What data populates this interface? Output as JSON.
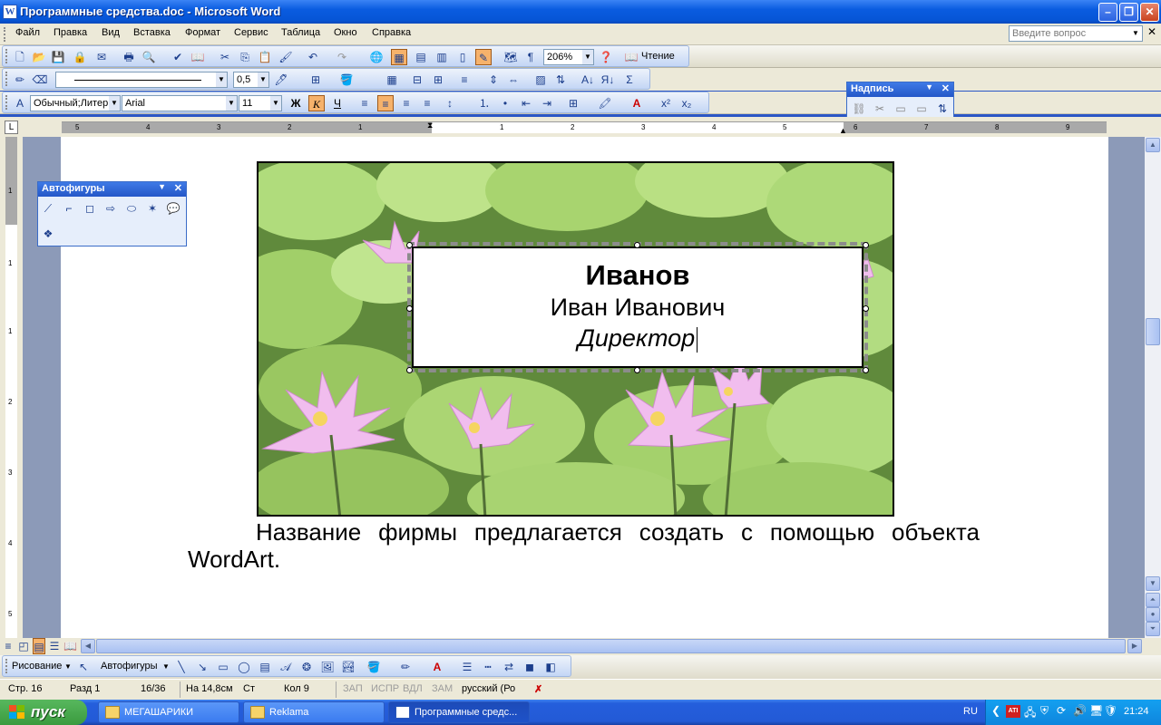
{
  "window": {
    "title": "Программные средства.doc - Microsoft Word",
    "app_icon": "W"
  },
  "menu": {
    "items": [
      "Файл",
      "Правка",
      "Вид",
      "Вставка",
      "Формат",
      "Сервис",
      "Таблица",
      "Окно",
      "Справка"
    ],
    "ask_placeholder": "Введите вопрос"
  },
  "standard_toolbar": {
    "zoom": "206%",
    "reading_label": "Чтение"
  },
  "drawing_format_toolbar": {
    "line_weight": "0,5"
  },
  "formatting_toolbar": {
    "style": "Обычный;Литер",
    "font": "Arial",
    "size": "11",
    "bold": "Ж",
    "italic": "К",
    "underline": "Ч"
  },
  "floating": {
    "textbox_toolbar_title": "Надпись",
    "autoshapes_toolbar_title": "Автофигуры"
  },
  "ruler": {
    "h_numbers": [
      "5",
      "4",
      "3",
      "2",
      "1",
      "1",
      "2",
      "3",
      "4",
      "5",
      "6",
      "7",
      "8",
      "9"
    ],
    "v_numbers": [
      "1",
      "1",
      "1",
      "2",
      "3",
      "4",
      "5"
    ]
  },
  "document": {
    "card": {
      "surname": "Иванов",
      "name": "Иван Иванович",
      "position": "Директор"
    },
    "body_text": "Название фирмы предлагается создать с помощью объекта WordArt."
  },
  "draw_toolbar": {
    "draw_label": "Рисование",
    "autoshapes_label": "Автофигуры"
  },
  "status": {
    "page": "Стр. 16",
    "section": "Разд 1",
    "pages": "16/36",
    "at": "На 14,8см",
    "line": "Ст",
    "col": "Кол 9",
    "rec": "ЗАП",
    "trk": "ИСПР",
    "ext": "ВДЛ",
    "ovr": "ЗАМ",
    "lang": "русский (Ро"
  },
  "taskbar": {
    "start": "пуск",
    "buttons": [
      "МЕГАШАРИКИ",
      "Reklama",
      "Программные средс..."
    ],
    "lang": "RU",
    "clock": "21:24"
  },
  "colors": {
    "title_blue": "#0a5ce0",
    "taskbar_blue": "#245edc",
    "start_green": "#3a9a3e"
  }
}
